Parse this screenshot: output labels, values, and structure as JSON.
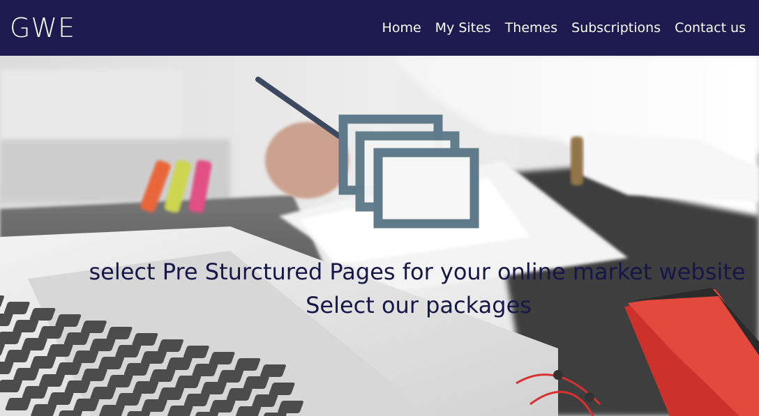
{
  "navbar": {
    "brand": "GWE",
    "links": [
      "Home",
      "My Sites",
      "Themes",
      "Subscriptions",
      "Contact us"
    ]
  },
  "hero": {
    "icon": "pages-stack-icon",
    "line1": "select Pre Sturctured Pages for your online market website",
    "line2": "Select our packages"
  },
  "colors": {
    "navbar_bg": "#1c1a4f",
    "nav_text": "#ffffff",
    "hero_text": "#161648",
    "icon_stroke": "#5f7a8a"
  }
}
